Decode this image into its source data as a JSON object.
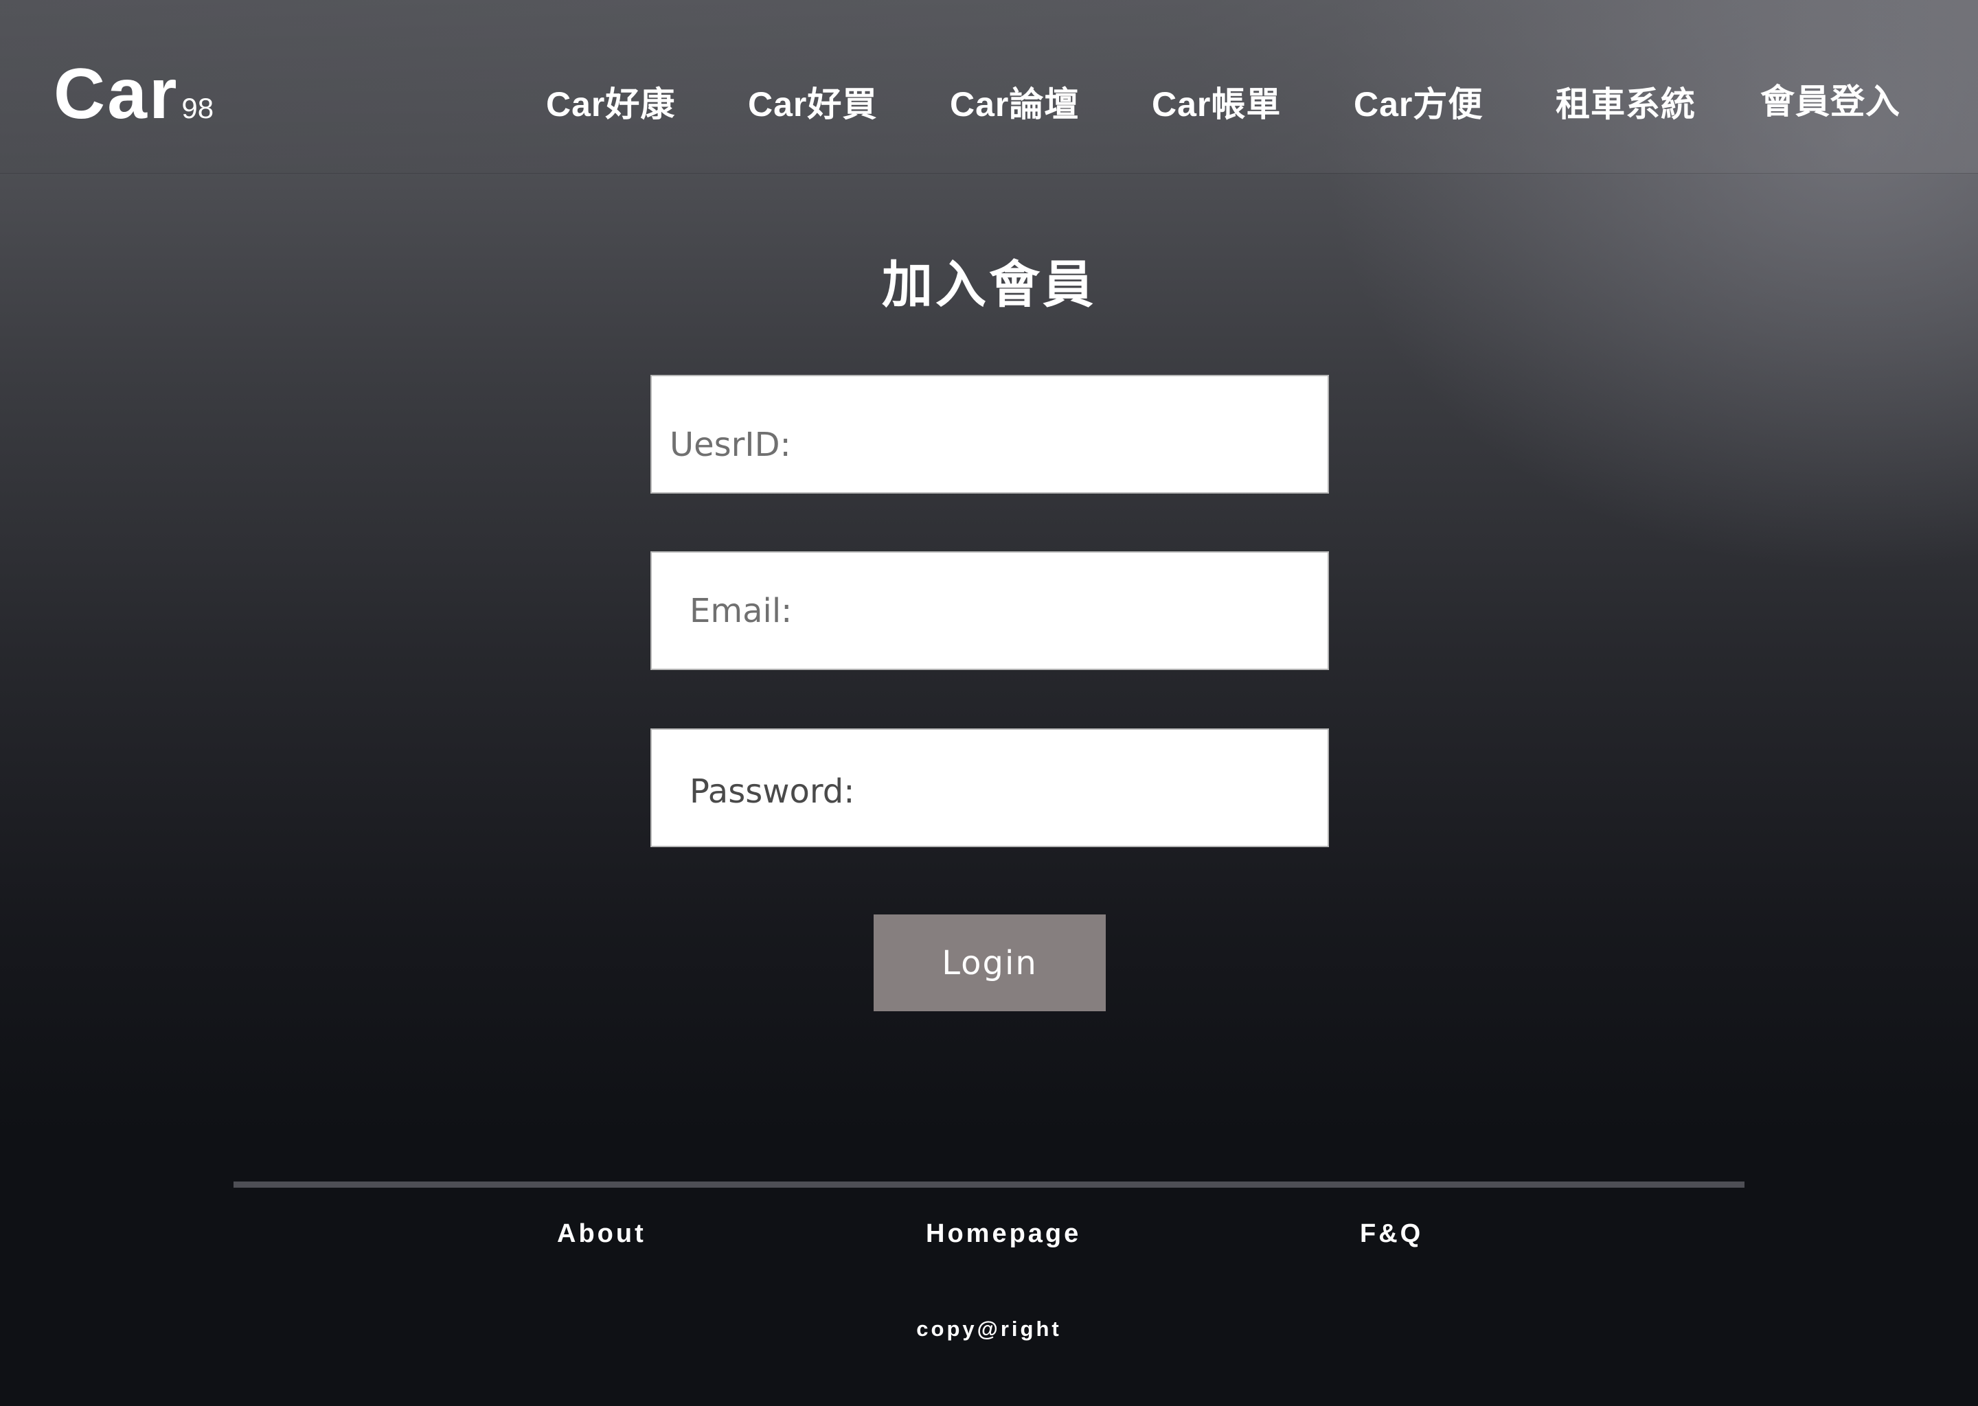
{
  "header": {
    "logo_main": "Car",
    "logo_sub": "98",
    "nav": [
      "Car好康",
      "Car好買",
      "Car論壇",
      "Car帳單",
      "Car方便",
      "租車系統",
      "會員登入"
    ]
  },
  "form": {
    "title": "加入會員",
    "userid_placeholder": "UesrID:",
    "email_placeholder": "Email:",
    "password_placeholder": "Password:",
    "login_label": "Login"
  },
  "footer": {
    "links": [
      "About",
      "Homepage",
      "F&Q"
    ],
    "copyright": "copy@right"
  },
  "colors": {
    "button": "#867f7f",
    "divider": "#4e4f55",
    "text": "#ffffff"
  }
}
